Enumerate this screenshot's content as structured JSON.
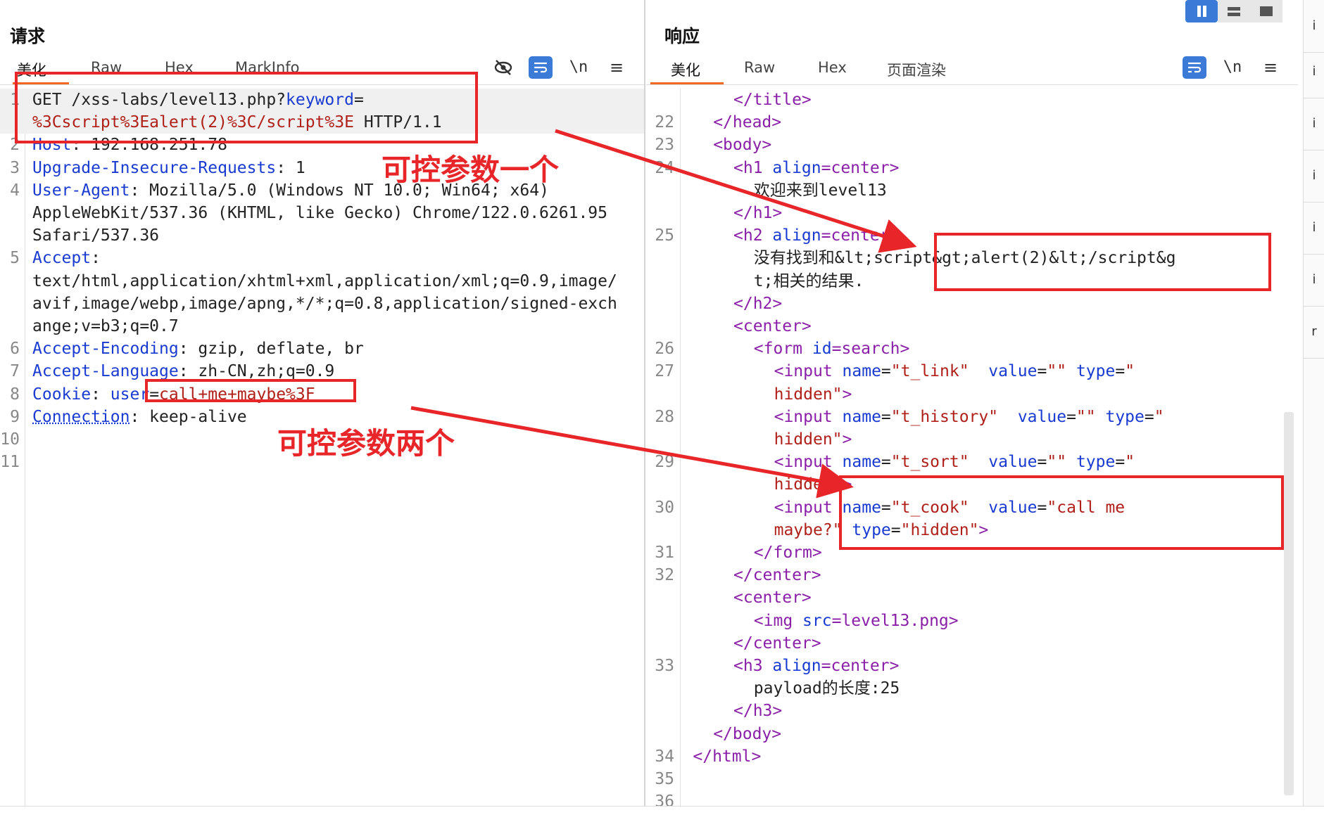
{
  "request": {
    "title": "请求",
    "tabs": [
      "美化",
      "Raw",
      "Hex",
      "MarkInfo"
    ],
    "toolbar": {
      "hide_icon": "eye-slash-icon",
      "wrap_icon": "wrap-icon",
      "newline_label": "\\n",
      "menu_icon": "hamburger-menu-icon"
    },
    "lines": [
      {
        "n": "1",
        "parts": [
          {
            "c": "tx",
            "t": "GET /xss-labs/level13.php?"
          },
          {
            "c": "k",
            "t": "keyword"
          },
          {
            "c": "tx",
            "t": "="
          }
        ]
      },
      {
        "n": "",
        "parts": [
          {
            "c": "s",
            "t": "%3Cscript%3Ealert(2)%3C/script%3E"
          },
          {
            "c": "tx",
            "t": " HTTP/1.1"
          }
        ]
      },
      {
        "n": "2",
        "parts": [
          {
            "c": "k",
            "t": "Host"
          },
          {
            "c": "tx",
            "t": ": 192.168.251.78"
          }
        ]
      },
      {
        "n": "3",
        "parts": [
          {
            "c": "k",
            "t": "Upgrade-Insecure-Requests"
          },
          {
            "c": "tx",
            "t": ": 1"
          }
        ]
      },
      {
        "n": "4",
        "parts": [
          {
            "c": "k",
            "t": "User-Agent"
          },
          {
            "c": "tx",
            "t": ": Mozilla/5.0 (Windows NT 10.0; Win64; x64)"
          }
        ]
      },
      {
        "n": "",
        "parts": [
          {
            "c": "tx",
            "t": "AppleWebKit/537.36 (KHTML, like Gecko) Chrome/122.0.6261.95"
          }
        ]
      },
      {
        "n": "",
        "parts": [
          {
            "c": "tx",
            "t": "Safari/537.36"
          }
        ]
      },
      {
        "n": "5",
        "parts": [
          {
            "c": "k",
            "t": "Accept"
          },
          {
            "c": "tx",
            "t": ":"
          }
        ]
      },
      {
        "n": "",
        "parts": [
          {
            "c": "tx",
            "t": "text/html,application/xhtml+xml,application/xml;q=0.9,image/"
          }
        ]
      },
      {
        "n": "",
        "parts": [
          {
            "c": "tx",
            "t": "avif,image/webp,image/apng,*/*;q=0.8,application/signed-exch"
          }
        ]
      },
      {
        "n": "",
        "parts": [
          {
            "c": "tx",
            "t": "ange;v=b3;q=0.7"
          }
        ]
      },
      {
        "n": "6",
        "parts": [
          {
            "c": "k",
            "t": "Accept-Encoding"
          },
          {
            "c": "tx",
            "t": ": gzip, deflate, br"
          }
        ]
      },
      {
        "n": "7",
        "parts": [
          {
            "c": "k",
            "t": "Accept-Language"
          },
          {
            "c": "tx",
            "t": ": zh-CN,zh;q=0.9"
          }
        ]
      },
      {
        "n": "8",
        "parts": [
          {
            "c": "k",
            "t": "Cookie"
          },
          {
            "c": "tx",
            "t": ": "
          },
          {
            "c": "k",
            "t": "user"
          },
          {
            "c": "tx",
            "t": "="
          },
          {
            "c": "s",
            "t": "call+me+maybe%3F"
          }
        ]
      },
      {
        "n": "9",
        "parts": [
          {
            "c": "k wavy",
            "t": "Connection"
          },
          {
            "c": "tx",
            "t": ": keep-alive"
          }
        ]
      },
      {
        "n": "10",
        "parts": []
      },
      {
        "n": "11",
        "parts": []
      }
    ]
  },
  "response": {
    "title": "响应",
    "tabs": [
      "美化",
      "Raw",
      "Hex",
      "页面渲染"
    ],
    "toolbar": {
      "wrap_icon": "wrap-icon",
      "newline_label": "\\n",
      "menu_icon": "hamburger-menu-icon"
    },
    "lines": [
      {
        "n": "",
        "indent": 5,
        "parts": [
          {
            "c": "t",
            "t": "</title>"
          }
        ]
      },
      {
        "n": "22",
        "indent": 3,
        "parts": [
          {
            "c": "t",
            "t": "</head>"
          }
        ]
      },
      {
        "n": "23",
        "indent": 3,
        "parts": [
          {
            "c": "t",
            "t": "<body>"
          }
        ]
      },
      {
        "n": "24",
        "indent": 5,
        "parts": [
          {
            "c": "t",
            "t": "<h1 "
          },
          {
            "c": "k",
            "t": "align"
          },
          {
            "c": "t",
            "t": "=center>"
          }
        ]
      },
      {
        "n": "",
        "indent": 7,
        "parts": [
          {
            "c": "tx",
            "t": "欢迎来到level13"
          }
        ]
      },
      {
        "n": "",
        "indent": 5,
        "parts": [
          {
            "c": "t",
            "t": "</h1>"
          }
        ]
      },
      {
        "n": "25",
        "indent": 5,
        "parts": [
          {
            "c": "t",
            "t": "<h2 "
          },
          {
            "c": "k",
            "t": "align"
          },
          {
            "c": "t",
            "t": "=center>"
          }
        ]
      },
      {
        "n": "",
        "indent": 7,
        "parts": [
          {
            "c": "tx",
            "t": "没有找到和&lt;script&gt;alert(2)&lt;/script&g"
          }
        ]
      },
      {
        "n": "",
        "indent": 7,
        "parts": [
          {
            "c": "tx",
            "t": "t;相关的结果."
          }
        ]
      },
      {
        "n": "",
        "indent": 5,
        "parts": [
          {
            "c": "t",
            "t": "</h2>"
          }
        ]
      },
      {
        "n": "",
        "indent": 5,
        "parts": [
          {
            "c": "t",
            "t": "<center>"
          }
        ]
      },
      {
        "n": "26",
        "indent": 7,
        "parts": [
          {
            "c": "t",
            "t": "<form "
          },
          {
            "c": "k",
            "t": "id"
          },
          {
            "c": "t",
            "t": "=search>"
          }
        ]
      },
      {
        "n": "27",
        "indent": 9,
        "parts": [
          {
            "c": "t",
            "t": "<input "
          },
          {
            "c": "k",
            "t": "name"
          },
          {
            "c": "tx",
            "t": "="
          },
          {
            "c": "s",
            "t": "\"t_link\""
          },
          {
            "c": "tx",
            "t": "  "
          },
          {
            "c": "k",
            "t": "value"
          },
          {
            "c": "tx",
            "t": "="
          },
          {
            "c": "s",
            "t": "\"\""
          },
          {
            "c": "tx",
            "t": " "
          },
          {
            "c": "k",
            "t": "type"
          },
          {
            "c": "tx",
            "t": "="
          },
          {
            "c": "s",
            "t": "\""
          }
        ]
      },
      {
        "n": "",
        "indent": 9,
        "parts": [
          {
            "c": "s",
            "t": "hidden\""
          },
          {
            "c": "t",
            "t": ">"
          }
        ]
      },
      {
        "n": "28",
        "indent": 9,
        "parts": [
          {
            "c": "t",
            "t": "<input "
          },
          {
            "c": "k",
            "t": "name"
          },
          {
            "c": "tx",
            "t": "="
          },
          {
            "c": "s",
            "t": "\"t_history\""
          },
          {
            "c": "tx",
            "t": "  "
          },
          {
            "c": "k",
            "t": "value"
          },
          {
            "c": "tx",
            "t": "="
          },
          {
            "c": "s",
            "t": "\"\""
          },
          {
            "c": "tx",
            "t": " "
          },
          {
            "c": "k",
            "t": "type"
          },
          {
            "c": "tx",
            "t": "="
          },
          {
            "c": "s",
            "t": "\""
          }
        ]
      },
      {
        "n": "",
        "indent": 9,
        "parts": [
          {
            "c": "s",
            "t": "hidden\""
          },
          {
            "c": "t",
            "t": ">"
          }
        ]
      },
      {
        "n": "29",
        "indent": 9,
        "parts": [
          {
            "c": "t",
            "t": "<input "
          },
          {
            "c": "k",
            "t": "name"
          },
          {
            "c": "tx",
            "t": "="
          },
          {
            "c": "s",
            "t": "\"t_sort\""
          },
          {
            "c": "tx",
            "t": "  "
          },
          {
            "c": "k",
            "t": "value"
          },
          {
            "c": "tx",
            "t": "="
          },
          {
            "c": "s",
            "t": "\"\""
          },
          {
            "c": "tx",
            "t": " "
          },
          {
            "c": "k",
            "t": "type"
          },
          {
            "c": "tx",
            "t": "="
          },
          {
            "c": "s",
            "t": "\""
          }
        ]
      },
      {
        "n": "",
        "indent": 9,
        "parts": [
          {
            "c": "s",
            "t": "hidden\""
          },
          {
            "c": "t",
            "t": ">"
          }
        ]
      },
      {
        "n": "30",
        "indent": 9,
        "parts": [
          {
            "c": "t",
            "t": "<input "
          },
          {
            "c": "k",
            "t": "name"
          },
          {
            "c": "tx",
            "t": "="
          },
          {
            "c": "s",
            "t": "\"t_cook\""
          },
          {
            "c": "tx",
            "t": "  "
          },
          {
            "c": "k",
            "t": "value"
          },
          {
            "c": "tx",
            "t": "="
          },
          {
            "c": "s",
            "t": "\"call me"
          }
        ]
      },
      {
        "n": "",
        "indent": 9,
        "parts": [
          {
            "c": "s",
            "t": "maybe?\""
          },
          {
            "c": "tx",
            "t": " "
          },
          {
            "c": "k",
            "t": "type"
          },
          {
            "c": "tx",
            "t": "="
          },
          {
            "c": "s",
            "t": "\"hidden\""
          },
          {
            "c": "t",
            "t": ">"
          }
        ]
      },
      {
        "n": "31",
        "indent": 7,
        "parts": [
          {
            "c": "t",
            "t": "</form>"
          }
        ]
      },
      {
        "n": "32",
        "indent": 5,
        "parts": [
          {
            "c": "t",
            "t": "</center>"
          }
        ]
      },
      {
        "n": "",
        "indent": 5,
        "parts": [
          {
            "c": "t",
            "t": "<center>"
          }
        ]
      },
      {
        "n": "",
        "indent": 7,
        "parts": [
          {
            "c": "t",
            "t": "<img "
          },
          {
            "c": "k",
            "t": "src"
          },
          {
            "c": "t",
            "t": "=level13.png>"
          }
        ]
      },
      {
        "n": "",
        "indent": 5,
        "parts": [
          {
            "c": "t",
            "t": "</center>"
          }
        ]
      },
      {
        "n": "33",
        "indent": 5,
        "parts": [
          {
            "c": "t",
            "t": "<h3 "
          },
          {
            "c": "k",
            "t": "align"
          },
          {
            "c": "t",
            "t": "=center>"
          }
        ]
      },
      {
        "n": "",
        "indent": 7,
        "parts": [
          {
            "c": "tx",
            "t": "payload的长度:25"
          }
        ]
      },
      {
        "n": "",
        "indent": 5,
        "parts": [
          {
            "c": "t",
            "t": "</h3>"
          }
        ]
      },
      {
        "n": "",
        "indent": 3,
        "parts": [
          {
            "c": "t",
            "t": "</body>"
          }
        ]
      },
      {
        "n": "34",
        "indent": 1,
        "parts": [
          {
            "c": "t",
            "t": "</html>"
          }
        ]
      },
      {
        "n": "35",
        "indent": 0,
        "parts": []
      },
      {
        "n": "36",
        "indent": 0,
        "parts": []
      }
    ]
  },
  "annotations": {
    "label_one": "可控参数一个",
    "label_two": "可控参数两个",
    "color": "#e8262a"
  },
  "layout_buttons": [
    "split-horizontal-icon",
    "split-vertical-icon",
    "single-pane-icon"
  ],
  "right_strip": [
    "i",
    "i",
    "i",
    "i",
    "i",
    "i",
    "r"
  ]
}
